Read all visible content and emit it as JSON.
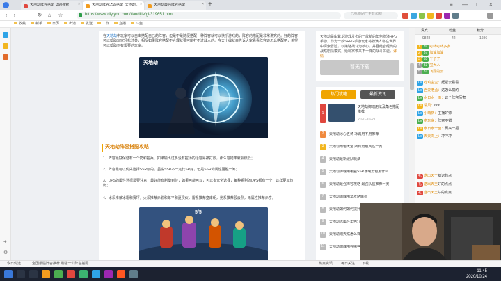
{
  "browser": {
    "tabs": [
      {
        "title": "天地劫阵容搭配_360搜索",
        "active": false
      },
      {
        "title": "天地劫阵容怎么搭配_天地劫..",
        "active": true
      },
      {
        "title": "天地劫最强阵容搭配",
        "active": false
      }
    ],
    "url": "https://www.dlyiyou.com/tiandijie/gl/319651.html",
    "search_placeholder": "已执搬刷厂主音和视",
    "bookmarks": [
      "收藏",
      "新手",
      "日历",
      "出道",
      "发送",
      "工作",
      "直播",
      "斗鱼"
    ]
  },
  "article": {
    "intro": "在天地劫中玩家可以自由搭配自己的阵容，但是不是随便搭配一种阵容就可以快乐游戏的，阵容的搭配是非常讲究的。好的阵容可以帮助玩家轻松过关，相反如果阵容搭配不合理就要可能打不过敌人的。今天小编就来告诉大家看看阵容该怎么搭配吧，希望可以帮助到有需要的玩家。",
    "intro_link": "天地劫",
    "section_title": "天地劫阵容搭配攻略",
    "paragraphs": [
      "1、阵容最好保证有一个奶和控兵。如果输出过多没有控场的话容易被打败，那么容错率就会很低；",
      "2、阵容最可以优先选择SSR级的，虽说SSR不一定比SR好，但是SSR的属性更胜一筹；",
      "3、DPS的属性选择需要注意，最好能有制衡到位，如果可能可以，可以多元化选择，每种系别的DPS都有一个，这样更加均衡；",
      "4、冰系推荐冰霜和赛坪，火系推荐赤影和郎平和夏侯仪，雷系推荐皇甫朝，光系推荐殷云烈，无属性推荐赤亭。"
    ],
    "image1_caption": "天地劫",
    "image2_caption": "5/5"
  },
  "download_panel": {
    "description": "天地劫是由紫龙游戏发布的一款新的角色扮演RPG手游，作为一款SRPG手游玩家将扮演人物在世界中探索冒险，以策略战斗为核心，并且结合经典的战略剧情模式，给玩家带来不一样的战斗体验。",
    "detail_link": "详情",
    "button": "暂无下载"
  },
  "hot_panel": {
    "tabs": [
      "热门攻略",
      "最新资讯"
    ],
    "featured": {
      "title": "天地劫御魂用法及角色搭配推荐",
      "date": "2020-10-21"
    },
    "items": [
      "天地劫冰心五骑 冰霜用不用推荐",
      "天地劫角色大全 所有角色属性一览",
      "天地劫最新破队玩法",
      "天地劫御魂用哪些SSR冰魂角色用什么",
      "天地劫最强阵容攻略 最强队伍推荐一览",
      "天地劫御魂用法攻略解析",
      "天地劫如何如何提升 魂能",
      "天地劫冰属性角色介绍 大全",
      "天地劫魂天赋怎么样",
      "天地劫御魂用在哪些"
    ]
  },
  "chat": {
    "header_tabs": [
      "贵宾",
      "粉丝",
      "积分"
    ],
    "stats": [
      "9848",
      "42",
      "1696"
    ],
    "top": [
      {
        "rank": "1",
        "name": "叮咚叮咚多多",
        "level": "39"
      },
      {
        "rank": "2",
        "name": "加油加油",
        "level": "37"
      },
      {
        "rank": "3",
        "name": "丫了了",
        "level": "35"
      },
      {
        "rank": "4",
        "name": "宝大人",
        "level": "33"
      },
      {
        "rank": "5",
        "name": "飞翔的云",
        "level": "31"
      }
    ],
    "messages": [
      {
        "name": "吃鸡宝宝：",
        "msg": "赶紧去看看"
      },
      {
        "name": "吾爱老孟：",
        "msg": "这怎么搞的"
      },
      {
        "name": "水日水一面：",
        "msg": "这个阵容厉害"
      },
      {
        "name": "清风：",
        "msg": "666"
      },
      {
        "name": "小萌新：",
        "msg": "主播好帅"
      },
      {
        "name": "老玩家：",
        "msg": "阵容不错"
      },
      {
        "name": "水日水一面：",
        "msg": "再来一把"
      },
      {
        "name": "天天向上：",
        "msg": "冲冲冲"
      }
    ],
    "gift_rows": [
      {
        "name": "送出天王",
        "msg": "知识的点"
      },
      {
        "name": "送出天王",
        "msg": "好的点点"
      },
      {
        "name": "送出天王",
        "msg": "好的点点"
      }
    ]
  },
  "status": {
    "left": "今日优选",
    "middle": "全国最强阵容推荐 最强一个阵容搭配",
    "right_items": [
      "热点资讯",
      "每日关注",
      "下载"
    ]
  },
  "taskbar": {
    "time": "11:45",
    "date": "2020/10/24"
  }
}
